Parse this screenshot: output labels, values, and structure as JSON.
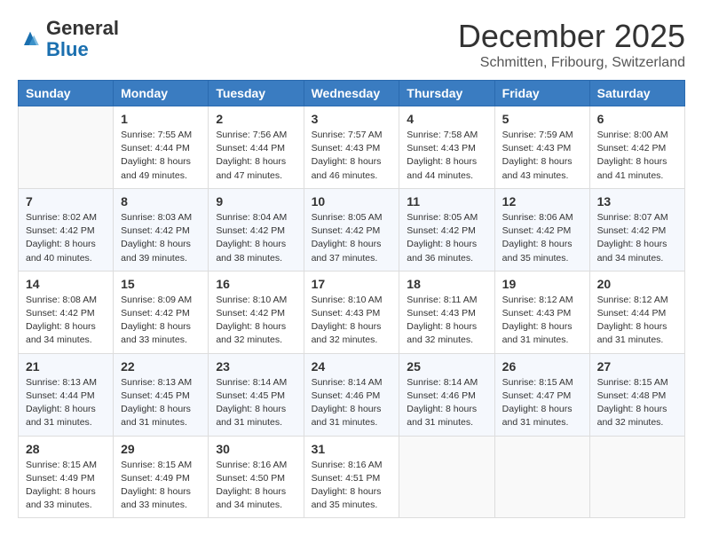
{
  "header": {
    "logo_line1": "General",
    "logo_line2": "Blue",
    "month_title": "December 2025",
    "subtitle": "Schmitten, Fribourg, Switzerland"
  },
  "days_of_week": [
    "Sunday",
    "Monday",
    "Tuesday",
    "Wednesday",
    "Thursday",
    "Friday",
    "Saturday"
  ],
  "weeks": [
    [
      {
        "day": "",
        "sunrise": "",
        "sunset": "",
        "daylight": ""
      },
      {
        "day": "1",
        "sunrise": "7:55 AM",
        "sunset": "4:44 PM",
        "daylight": "8 hours and 49 minutes."
      },
      {
        "day": "2",
        "sunrise": "7:56 AM",
        "sunset": "4:44 PM",
        "daylight": "8 hours and 47 minutes."
      },
      {
        "day": "3",
        "sunrise": "7:57 AM",
        "sunset": "4:43 PM",
        "daylight": "8 hours and 46 minutes."
      },
      {
        "day": "4",
        "sunrise": "7:58 AM",
        "sunset": "4:43 PM",
        "daylight": "8 hours and 44 minutes."
      },
      {
        "day": "5",
        "sunrise": "7:59 AM",
        "sunset": "4:43 PM",
        "daylight": "8 hours and 43 minutes."
      },
      {
        "day": "6",
        "sunrise": "8:00 AM",
        "sunset": "4:42 PM",
        "daylight": "8 hours and 41 minutes."
      }
    ],
    [
      {
        "day": "7",
        "sunrise": "8:02 AM",
        "sunset": "4:42 PM",
        "daylight": "8 hours and 40 minutes."
      },
      {
        "day": "8",
        "sunrise": "8:03 AM",
        "sunset": "4:42 PM",
        "daylight": "8 hours and 39 minutes."
      },
      {
        "day": "9",
        "sunrise": "8:04 AM",
        "sunset": "4:42 PM",
        "daylight": "8 hours and 38 minutes."
      },
      {
        "day": "10",
        "sunrise": "8:05 AM",
        "sunset": "4:42 PM",
        "daylight": "8 hours and 37 minutes."
      },
      {
        "day": "11",
        "sunrise": "8:05 AM",
        "sunset": "4:42 PM",
        "daylight": "8 hours and 36 minutes."
      },
      {
        "day": "12",
        "sunrise": "8:06 AM",
        "sunset": "4:42 PM",
        "daylight": "8 hours and 35 minutes."
      },
      {
        "day": "13",
        "sunrise": "8:07 AM",
        "sunset": "4:42 PM",
        "daylight": "8 hours and 34 minutes."
      }
    ],
    [
      {
        "day": "14",
        "sunrise": "8:08 AM",
        "sunset": "4:42 PM",
        "daylight": "8 hours and 34 minutes."
      },
      {
        "day": "15",
        "sunrise": "8:09 AM",
        "sunset": "4:42 PM",
        "daylight": "8 hours and 33 minutes."
      },
      {
        "day": "16",
        "sunrise": "8:10 AM",
        "sunset": "4:42 PM",
        "daylight": "8 hours and 32 minutes."
      },
      {
        "day": "17",
        "sunrise": "8:10 AM",
        "sunset": "4:43 PM",
        "daylight": "8 hours and 32 minutes."
      },
      {
        "day": "18",
        "sunrise": "8:11 AM",
        "sunset": "4:43 PM",
        "daylight": "8 hours and 32 minutes."
      },
      {
        "day": "19",
        "sunrise": "8:12 AM",
        "sunset": "4:43 PM",
        "daylight": "8 hours and 31 minutes."
      },
      {
        "day": "20",
        "sunrise": "8:12 AM",
        "sunset": "4:44 PM",
        "daylight": "8 hours and 31 minutes."
      }
    ],
    [
      {
        "day": "21",
        "sunrise": "8:13 AM",
        "sunset": "4:44 PM",
        "daylight": "8 hours and 31 minutes."
      },
      {
        "day": "22",
        "sunrise": "8:13 AM",
        "sunset": "4:45 PM",
        "daylight": "8 hours and 31 minutes."
      },
      {
        "day": "23",
        "sunrise": "8:14 AM",
        "sunset": "4:45 PM",
        "daylight": "8 hours and 31 minutes."
      },
      {
        "day": "24",
        "sunrise": "8:14 AM",
        "sunset": "4:46 PM",
        "daylight": "8 hours and 31 minutes."
      },
      {
        "day": "25",
        "sunrise": "8:14 AM",
        "sunset": "4:46 PM",
        "daylight": "8 hours and 31 minutes."
      },
      {
        "day": "26",
        "sunrise": "8:15 AM",
        "sunset": "4:47 PM",
        "daylight": "8 hours and 31 minutes."
      },
      {
        "day": "27",
        "sunrise": "8:15 AM",
        "sunset": "4:48 PM",
        "daylight": "8 hours and 32 minutes."
      }
    ],
    [
      {
        "day": "28",
        "sunrise": "8:15 AM",
        "sunset": "4:49 PM",
        "daylight": "8 hours and 33 minutes."
      },
      {
        "day": "29",
        "sunrise": "8:15 AM",
        "sunset": "4:49 PM",
        "daylight": "8 hours and 33 minutes."
      },
      {
        "day": "30",
        "sunrise": "8:16 AM",
        "sunset": "4:50 PM",
        "daylight": "8 hours and 34 minutes."
      },
      {
        "day": "31",
        "sunrise": "8:16 AM",
        "sunset": "4:51 PM",
        "daylight": "8 hours and 35 minutes."
      },
      {
        "day": "",
        "sunrise": "",
        "sunset": "",
        "daylight": ""
      },
      {
        "day": "",
        "sunrise": "",
        "sunset": "",
        "daylight": ""
      },
      {
        "day": "",
        "sunrise": "",
        "sunset": "",
        "daylight": ""
      }
    ]
  ],
  "labels": {
    "sunrise": "Sunrise:",
    "sunset": "Sunset:",
    "daylight": "Daylight:"
  }
}
